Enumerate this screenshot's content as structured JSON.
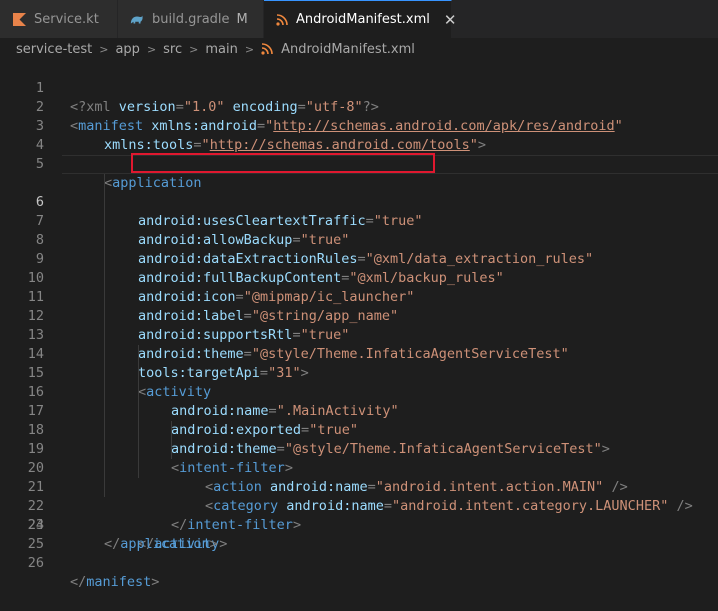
{
  "tabs": [
    {
      "label": "Service.kt",
      "icon": "kotlin-icon",
      "modified": "",
      "active": false
    },
    {
      "label": "build.gradle",
      "icon": "gradle-icon",
      "modified": "M",
      "active": false
    },
    {
      "label": "AndroidManifest.xml",
      "icon": "xml-rss-icon",
      "modified": "",
      "active": true,
      "close": "✕"
    }
  ],
  "breadcrumb": [
    "service-test",
    "app",
    "src",
    "main",
    "AndroidManifest.xml"
  ],
  "colors": {
    "accent": "#3794ff",
    "highlight_box": "#e0182f",
    "string": "#ce9178",
    "tag": "#569cd6",
    "attribute": "#9cdcfe"
  },
  "line_numbers": [
    "1",
    "2",
    "3",
    "4",
    "5",
    "6",
    "7",
    "8",
    "9",
    "10",
    "11",
    "12",
    "13",
    "14",
    "15",
    "16",
    "17",
    "18",
    "19",
    "20",
    "21",
    "22",
    "23",
    "24",
    "25",
    "26"
  ],
  "current_line": "6",
  "code": {
    "l1": {
      "p1": "<?xml ",
      "a1": "version",
      "eq1": "=",
      "s1": "\"1.0\"",
      "a2": " encoding",
      "eq2": "=",
      "s2": "\"utf-8\"",
      "p2": "?>"
    },
    "l2": {
      "p1": "<",
      "tag": "manifest",
      "a1": " xmlns:android",
      "eq1": "=",
      "q1": "\"",
      "link": "http://schemas.android.com/apk/res/android",
      "q2": "\""
    },
    "l3": {
      "a1": "xmlns:tools",
      "eq1": "=",
      "q1": "\"",
      "link": "http://schemas.android.com/tools",
      "q2": "\"",
      "p2": ">"
    },
    "l5": {
      "p1": "<",
      "tag": "application"
    },
    "l6": {
      "a1": "android:usesCleartextTraffic",
      "eq1": "=",
      "s1": "\"true\""
    },
    "l7": {
      "a1": "android:allowBackup",
      "eq1": "=",
      "s1": "\"true\""
    },
    "l8": {
      "a1": "android:dataExtractionRules",
      "eq1": "=",
      "s1": "\"@xml/data_extraction_rules\""
    },
    "l9": {
      "a1": "android:fullBackupContent",
      "eq1": "=",
      "s1": "\"@xml/backup_rules\""
    },
    "l10": {
      "a1": "android:icon",
      "eq1": "=",
      "s1": "\"@mipmap/ic_launcher\""
    },
    "l11": {
      "a1": "android:label",
      "eq1": "=",
      "s1": "\"@string/app_name\""
    },
    "l12": {
      "a1": "android:supportsRtl",
      "eq1": "=",
      "s1": "\"true\""
    },
    "l13": {
      "a1": "android:theme",
      "eq1": "=",
      "s1": "\"@style/Theme.InfaticaAgentServiceTest\""
    },
    "l14": {
      "a1": "tools:targetApi",
      "eq1": "=",
      "s1": "\"31\"",
      "p2": ">"
    },
    "l15": {
      "p1": "<",
      "tag": "activity"
    },
    "l16": {
      "a1": "android:name",
      "eq1": "=",
      "s1": "\".MainActivity\""
    },
    "l17": {
      "a1": "android:exported",
      "eq1": "=",
      "s1": "\"true\""
    },
    "l18": {
      "a1": "android:theme",
      "eq1": "=",
      "s1": "\"@style/Theme.InfaticaAgentServiceTest\"",
      "p2": ">"
    },
    "l19": {
      "p1": "<",
      "tag": "intent-filter",
      "p2": ">"
    },
    "l20": {
      "p1": "<",
      "tag": "action",
      "a1": " android:name",
      "eq1": "=",
      "s1": "\"android.intent.action.MAIN\"",
      "p2": " />"
    },
    "l21": {
      "p1": "<",
      "tag": "category",
      "a1": " android:name",
      "eq1": "=",
      "s1": "\"android.intent.category.LAUNCHER\"",
      "p2": " />"
    },
    "l22": {
      "p1": "</",
      "tag": "intent-filter",
      "p2": ">"
    },
    "l23": {
      "p1": "</",
      "tag": "activity",
      "p2": ">"
    },
    "l24": {
      "p1": "</",
      "tag": "application",
      "p2": ">"
    },
    "l26": {
      "p1": "</",
      "tag": "manifest",
      "p2": ">"
    }
  }
}
